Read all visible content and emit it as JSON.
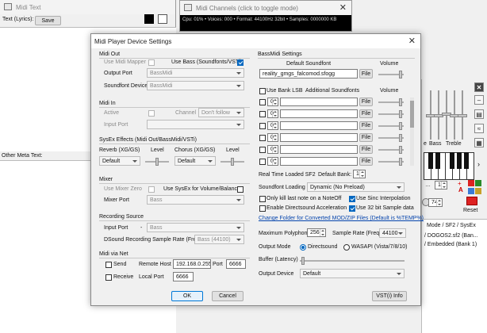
{
  "bg": {
    "midi_text": {
      "title": "Midi Text",
      "label": "Text (Lyrics):",
      "save": "Save",
      "meta_label": "Other Meta Text:"
    },
    "midi_channels": {
      "title": "Midi Channels (click to toggle mode)",
      "status": "Cpu: 01% • Voices: 000 • Format: 44100Hz 32bit • Samples: 0000000 KB"
    },
    "right_panel": {
      "bass": "Bass",
      "treble": "Treble",
      "value": "74",
      "reset": "Reset",
      "mode_header": "Mode / SF2 / SysEx",
      "lines": [
        "/ DOGOS2.sf2 (Ban...",
        "/ Embedded (Bank 1)"
      ],
      "partial": "e"
    }
  },
  "dialog": {
    "title": "Midi Player Device Settings",
    "close": "✕",
    "midi_out": {
      "header": "Midi Out",
      "use_mapper": "Use Midi Mapper",
      "use_bass": "Use Bass (Soundfonts/VSTi)",
      "output_port_label": "Output Port",
      "output_port_value": "BassMidi",
      "sf_device_label": "Soundfont Device",
      "sf_device_value": "BassMidi"
    },
    "midi_in": {
      "header": "Midi In",
      "active": "Active",
      "channel_label": "Channel",
      "channel_value": "Don't follow",
      "input_port_label": "Input Port",
      "input_port_value": ""
    },
    "sysex": {
      "header": "SysEx Effects (Midi Out/BassMidi/VSTi)",
      "reverb_label": "Reverb (XG/GS)",
      "chorus_label": "Chorus (XG/GS)",
      "level1": "Level",
      "level2": "Level",
      "reverb_value": "Default",
      "chorus_value": "Default"
    },
    "mixer": {
      "header": "Mixer",
      "use_zero": "Use Mixer Zero",
      "use_sysex_vol": "Use SysEx for Volume/Balance",
      "port_label": "Mixer Port",
      "port_value": "Bass"
    },
    "recording": {
      "header": "Recording Source",
      "input_port_label": "Input Port",
      "input_port_dash": "-",
      "input_port_value": "Bass",
      "dsound_label": "DSound Recording Sample Rate (Freq)",
      "dsound_value": "Bass (44100)"
    },
    "net": {
      "header": "Midi via Net",
      "send": "Send",
      "receive": "Receive",
      "remote_host_label": "Remote Host",
      "remote_host_value": "192.168.0.255",
      "port_label": "Port",
      "port_value": "6666",
      "local_port_label": "Local Port",
      "local_port_value": "6666"
    },
    "bassmidi": {
      "header": "BassMidi Settings",
      "default_sf_label": "Default Soundfont",
      "volume_label": "Volume",
      "default_sf_value": "reality_gmgs_falcomod.sfogg",
      "file_label": "File",
      "use_bank_lsb": "Use Bank LSB",
      "additional_sf_label": "Additional Soundfonts",
      "volume_label2": "Volume",
      "sf_rows": [
        {
          "bank": "0",
          "file": "File"
        },
        {
          "bank": "0",
          "file": "File"
        },
        {
          "bank": "0",
          "file": "File"
        },
        {
          "bank": "0",
          "file": "File"
        },
        {
          "bank": "0",
          "file": "File"
        },
        {
          "bank": "0",
          "file": "File"
        }
      ],
      "rtl_label": "Real Time Loaded SF2",
      "default_bank_label": "Default Bank:",
      "default_bank_value": "1",
      "sf_loading_label": "Soundfont Loading",
      "sf_loading_value": "Dynamic (No Preload)",
      "only_kill": "Only kill last note on a NoteOff",
      "use_sinc": "Use Sinc Interpolation",
      "enable_ds": "Enable Directsound Acceleration",
      "use_32bit": "Use 32 bit Sample data",
      "change_folder": "Change Folder for Converted MOD/ZIP Files (Default is %TEMP%)",
      "max_poly_label": "Maximum Polyphony",
      "max_poly_value": "256",
      "sample_rate_label": "Sample Rate (Freq)",
      "sample_rate_value": "44100",
      "output_mode_label": "Output Mode",
      "output_ds": "Directsound",
      "output_wasapi": "WASAPI (Vista/7/8/10)",
      "buffer_label": "Buffer (Latency)",
      "output_device_label": "Output Device",
      "output_device_value": "Default"
    },
    "ok": "OK",
    "cancel": "Cancel",
    "vsti": "VST(i) Info"
  }
}
